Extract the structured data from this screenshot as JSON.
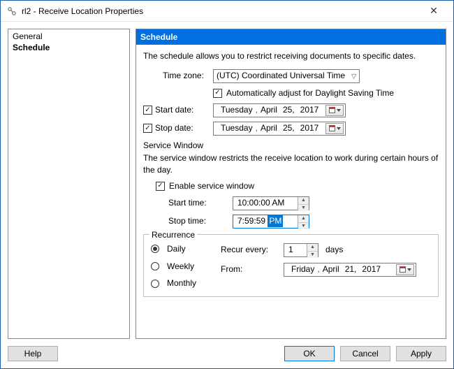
{
  "title": "rl2 - Receive Location Properties",
  "nav": {
    "items": [
      "General",
      "Schedule"
    ],
    "selected": 1
  },
  "panel": {
    "header": "Schedule",
    "description": "The schedule allows you to restrict receiving documents to specific dates.",
    "timezone": {
      "label": "Time zone:",
      "value": "(UTC) Coordinated Universal Time"
    },
    "autoDst": {
      "checked": true,
      "label": "Automatically adjust for Daylight Saving Time"
    },
    "startDate": {
      "checked": true,
      "label": "Start date:",
      "weekday": "Tuesday",
      "month": "April",
      "day": "25,",
      "year": "2017"
    },
    "stopDate": {
      "checked": true,
      "label": "Stop date:",
      "weekday": "Tuesday",
      "month": "April",
      "day": "25,",
      "year": "2017"
    },
    "serviceWindow": {
      "title": "Service Window",
      "description": "The service window restricts the receive location to work during certain hours of the day.",
      "enable": {
        "checked": true,
        "label": "Enable service window"
      },
      "startTime": {
        "label": "Start time:",
        "value": "10:00:00 AM"
      },
      "stopTime": {
        "label": "Stop time:",
        "value": "7:59:59",
        "ampm": "PM"
      }
    },
    "recurrence": {
      "title": "Recurrence",
      "options": [
        "Daily",
        "Weekly",
        "Monthly"
      ],
      "selected": 0,
      "recurEveryLabel": "Recur every:",
      "recurEveryValue": "1",
      "recurUnit": "days",
      "fromLabel": "From:",
      "from": {
        "weekday": "Friday",
        "month": "April",
        "day": "21,",
        "year": "2017"
      }
    }
  },
  "buttons": {
    "help": "Help",
    "ok": "OK",
    "cancel": "Cancel",
    "apply": "Apply"
  }
}
